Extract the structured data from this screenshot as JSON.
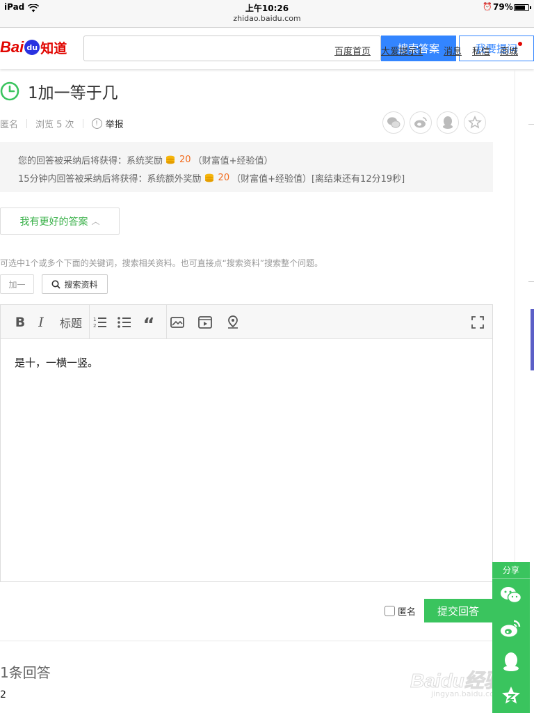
{
  "status_bar": {
    "device": "iPad",
    "time": "上午10:26",
    "url": "zhidao.baidu.com",
    "battery": "79%",
    "battery_level": 0.79
  },
  "header": {
    "logo_text_red": "Bai",
    "logo_paw": "du",
    "logo_product": "知道",
    "search_value": "",
    "search_answer_button": "搜索答案",
    "ask_button": "我要提问",
    "nav": [
      "百度首页",
      "大爱提示1",
      "消息",
      "私信",
      "商城"
    ]
  },
  "question": {
    "title": "1加一等于几",
    "author": "匿名",
    "views": "浏览 5 次",
    "report": "举报"
  },
  "reward": {
    "line1_prefix": "您的回答被采纳后将获得：系统奖励",
    "line1_num": "20",
    "line1_suffix": "（财富值+经验值）",
    "line2_prefix": "15分钟内回答被采纳后将获得：系统额外奖励",
    "line2_num": "20",
    "line2_suffix": "（财富值+经验值）[离结束还有12分19秒]"
  },
  "better_answer_button": "我有更好的答案",
  "keyword_hint": "可选中1个或多个下面的关键词，搜索相关资料。也可直接点“搜索资料”搜索整个问题。",
  "keyword_tag": "加一",
  "search_data_button": "搜索资料",
  "editor": {
    "heading_button": "标题",
    "content": "是十，一横一竖。"
  },
  "anonymous_label": "匿名",
  "submit_button": "提交回答",
  "answers": {
    "title": "1条回答",
    "snippet": "2"
  },
  "float_share": {
    "label": "分享",
    "items": [
      "wechat-icon",
      "weibo-icon",
      "qq-icon",
      "qzone-icon"
    ]
  },
  "watermark": {
    "main": "Baidu经验",
    "sub": "jingyan.baidu.com"
  },
  "colors": {
    "baidu_red": "#e10601",
    "baidu_blue": "#3385ff",
    "green": "#3ac45e",
    "orange": "#f26b1d"
  }
}
